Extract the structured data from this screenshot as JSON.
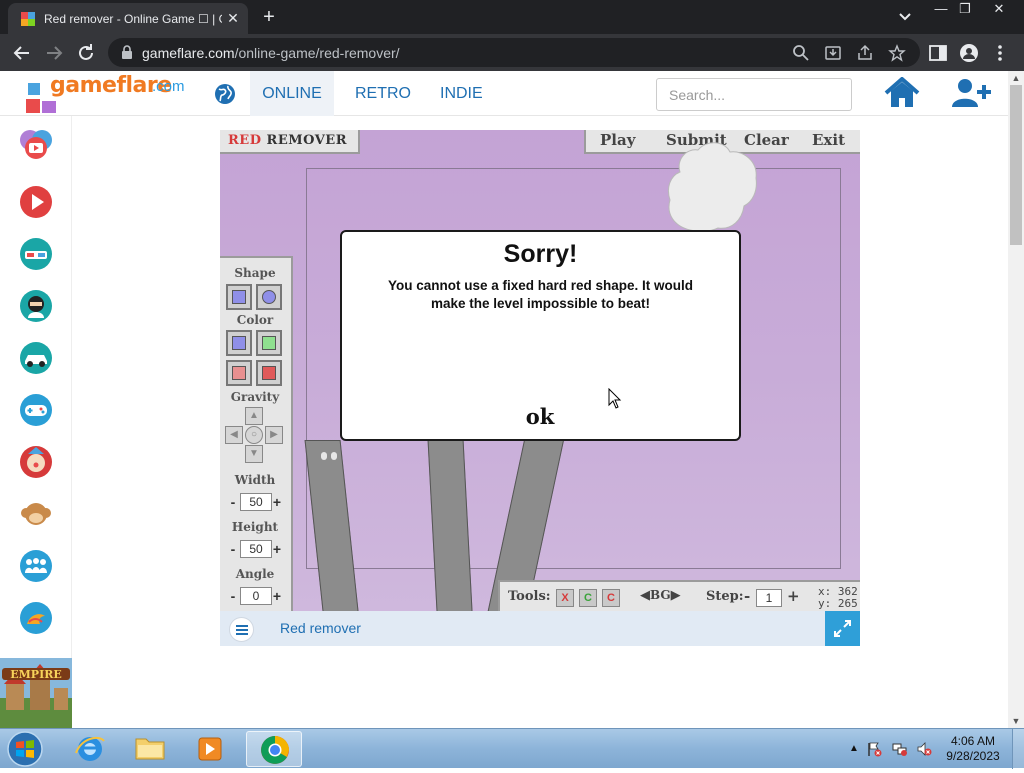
{
  "browser": {
    "tab_title": "Red remover - Online Game ☐ | G",
    "url_host": "gameflare.com",
    "url_path": "/online-game/red-remover/"
  },
  "site": {
    "logo_text": "gameflare",
    "logo_suffix": ".com",
    "nav": [
      "ONLINE",
      "RETRO",
      "INDIE"
    ],
    "search_placeholder": "Search...",
    "brand_color": "#1f6fb2",
    "accent_color": "#2f9fd8"
  },
  "sidebar": {
    "items": [
      "youtube-icon",
      "play-icon",
      "3d-glasses-icon",
      "ninja-icon",
      "car-icon",
      "gamepad-icon",
      "clown-icon",
      "monkey-icon",
      "people-icon",
      "bird-icon"
    ],
    "ad_text": "EMPIRE"
  },
  "game": {
    "title_red": "RED",
    "title_rest": " REMOVER",
    "menu": [
      "Play",
      "Submit",
      "Clear",
      "Exit"
    ],
    "panel": {
      "shape_label": "Shape",
      "color_label": "Color",
      "gravity_label": "Gravity",
      "width_label": "Width",
      "width_value": "50",
      "height_label": "Height",
      "height_value": "50",
      "angle_label": "Angle",
      "angle_value": "0",
      "minus": "-",
      "plus": "+"
    },
    "bottom": {
      "tools_label": "Tools:",
      "tools": [
        "X",
        "C",
        "C"
      ],
      "bg_label": "BG",
      "step_label": "Step:",
      "step_value": "1",
      "coord_x": "x: 362",
      "coord_y": "y: 265"
    },
    "dialog": {
      "title": "Sorry!",
      "message": "You cannot use a fixed hard red shape.  It would make the level impossible to beat!",
      "ok": "ok"
    }
  },
  "footer": {
    "game_name": "Red remover"
  },
  "taskbar": {
    "time": "4:06 AM",
    "date": "9/28/2023"
  }
}
